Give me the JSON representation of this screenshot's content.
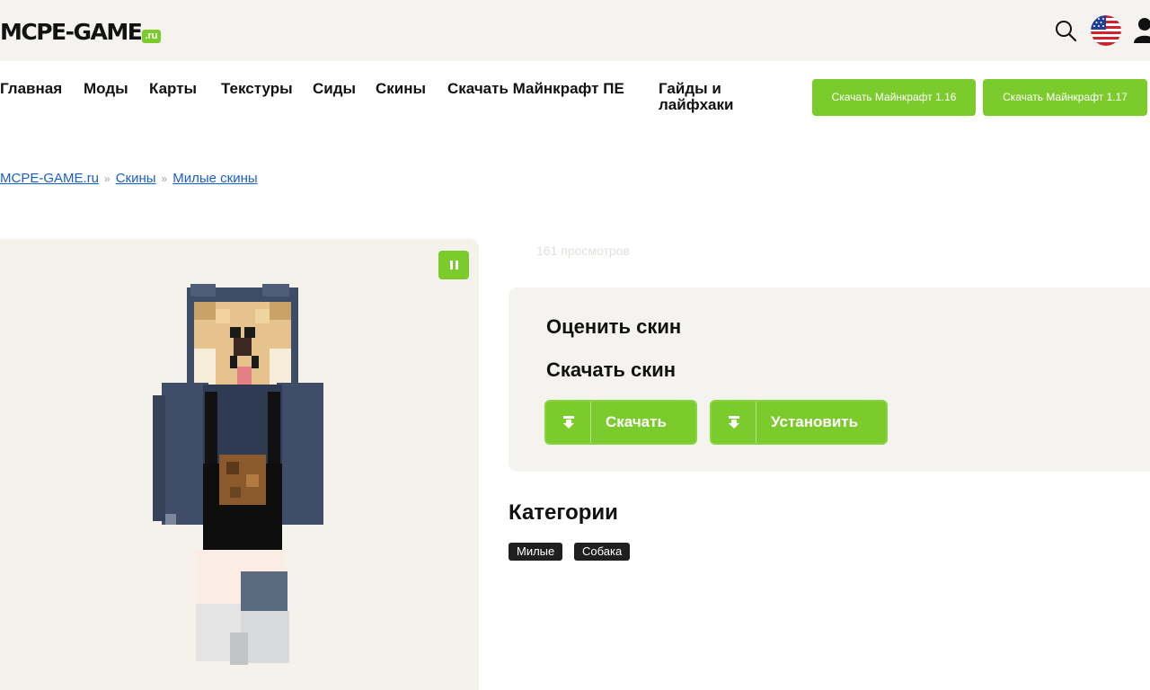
{
  "header": {
    "logo_text": "MCPE-GAME",
    "logo_suffix": ".ru",
    "icons": [
      "search-icon",
      "us-flag-icon",
      "user-icon"
    ]
  },
  "nav": {
    "items": [
      {
        "label": "Главная"
      },
      {
        "label": "Моды"
      },
      {
        "label": "Карты"
      },
      {
        "label": "Текстуры"
      },
      {
        "label": "Сиды"
      },
      {
        "label": "Скины"
      },
      {
        "label": "Скачать Майнкрафт ПЕ"
      },
      {
        "label": "Гайды и лайфхаки"
      }
    ],
    "download_buttons": [
      {
        "label": "Скачать Майнкрафт 1.16"
      },
      {
        "label": "Скачать Майнкрафт 1.17"
      }
    ]
  },
  "breadcrumb": {
    "items": [
      "MCPE-GAME.ru",
      "Скины",
      "Милые скины"
    ],
    "separator": "»"
  },
  "skin": {
    "views": "161 просмотров",
    "preview_icon": "pause-icon"
  },
  "actions": {
    "rate_title": "Оценить скин",
    "download_title": "Скачать скин",
    "download_label": "Скачать",
    "install_label": "Установить",
    "button_icon": "download-icon"
  },
  "categories": {
    "title": "Категории",
    "tags": [
      "Милые",
      "Собака"
    ]
  },
  "colors": {
    "accent": "#7ccb2d",
    "link": "#1a5fd1",
    "panel_bg": "#f5f3ef",
    "tag_bg": "#1f1f1f"
  }
}
